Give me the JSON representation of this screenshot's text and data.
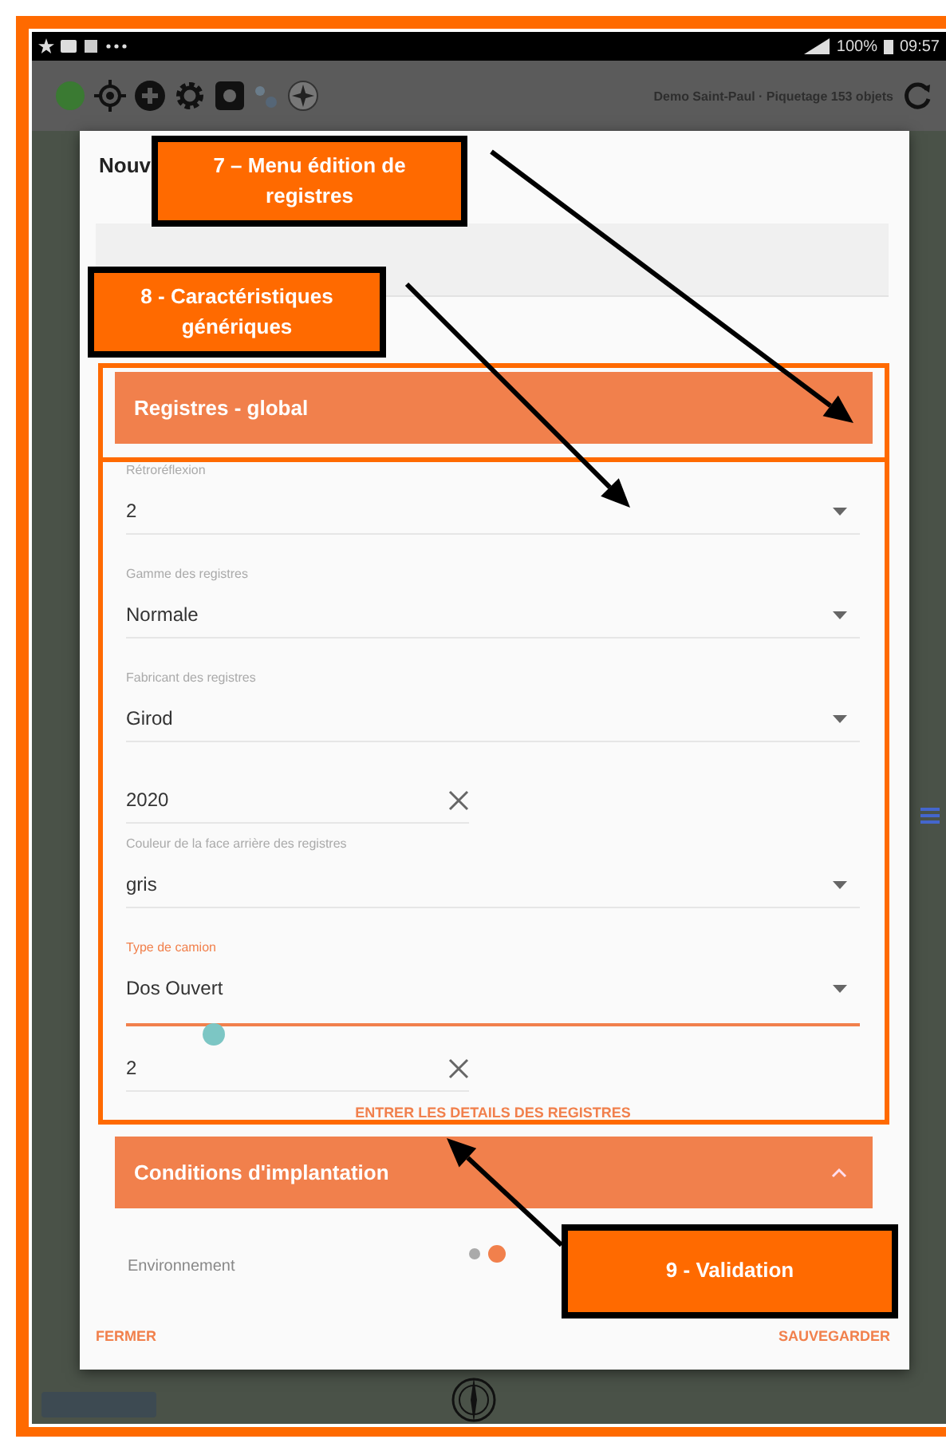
{
  "status_bar": {
    "battery": "100%",
    "time": "09:57"
  },
  "app_bar": {
    "project": "Demo Saint-Paul · Piquetage 153 objets"
  },
  "dialog": {
    "title": "Nouv",
    "sections": [
      {
        "title": "Registres - global",
        "expanded": true,
        "fields": [
          {
            "kind": "select",
            "label": "Rétroréflexion",
            "value": "2",
            "focused": false
          },
          {
            "kind": "select",
            "label": "Gamme des registres",
            "value": "Normale",
            "focused": false
          },
          {
            "kind": "select",
            "label": "Fabricant des registres",
            "value": "Girod",
            "focused": false
          },
          {
            "kind": "text",
            "value": "2020"
          },
          {
            "kind": "select",
            "label": "Couleur de la face arrière des registres",
            "value": "gris",
            "focused": false
          },
          {
            "kind": "select",
            "label": "Type de camion",
            "value": "Dos Ouvert",
            "focused": true
          },
          {
            "kind": "slider",
            "level": 0.12
          },
          {
            "kind": "text",
            "value": "2"
          }
        ],
        "action": "ENTRER LES DETAILS DES REGISTRES"
      },
      {
        "title": "Conditions d'implantation",
        "expanded": true
      }
    ],
    "pager": [
      {
        "selected": false
      },
      {
        "selected": true
      }
    ],
    "next_label": "Environnement",
    "buttons": {
      "close": "FERMER",
      "save": "SAUVEGARDER"
    }
  },
  "annotations": [
    {
      "text": "7 – Menu édition de registres"
    },
    {
      "text": "8 - Caractéristiques génériques"
    },
    {
      "text": "9 - Validation"
    }
  ]
}
